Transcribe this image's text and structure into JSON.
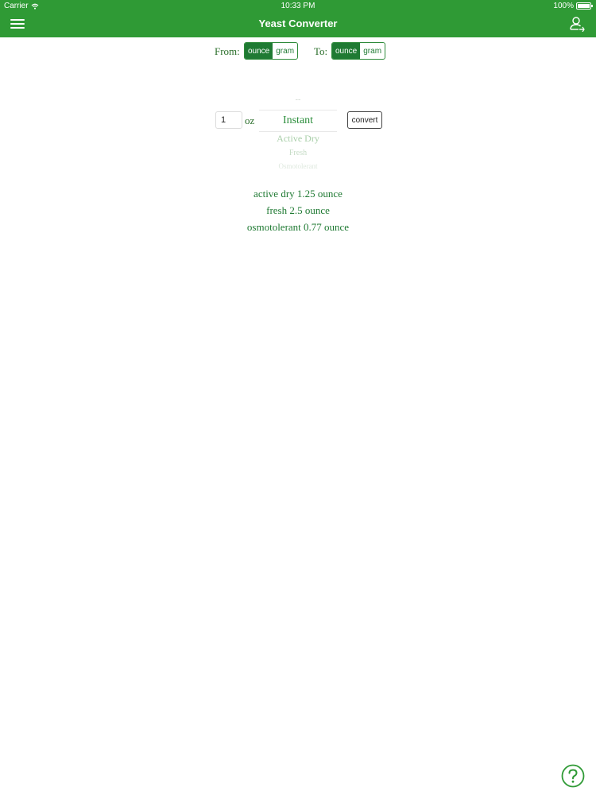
{
  "status_bar": {
    "carrier": "Carrier",
    "time": "10:33 PM",
    "battery": "100%"
  },
  "header": {
    "title": "Yeast Converter",
    "menu_icon": "menu-icon",
    "profile_icon": "profile-icon"
  },
  "from": {
    "label": "From:",
    "options": [
      "ounce",
      "gram"
    ],
    "selected": "ounce"
  },
  "to": {
    "label": "To:",
    "options": [
      "ounce",
      "gram"
    ],
    "selected": "ounce"
  },
  "converter": {
    "quantity": "1",
    "unit": "oz",
    "picker": {
      "prev_item": "--",
      "selected": "Instant",
      "next_items": [
        "Active Dry",
        "Fresh",
        "Osmotolerant"
      ]
    },
    "convert_label": "convert"
  },
  "results": [
    "active dry 1.25 ounce",
    "fresh 2.5 ounce",
    "osmotolerant 0.77 ounce"
  ],
  "colors": {
    "header": "#2f9a35",
    "accent": "#1f7a33"
  },
  "help_icon": "help-icon"
}
